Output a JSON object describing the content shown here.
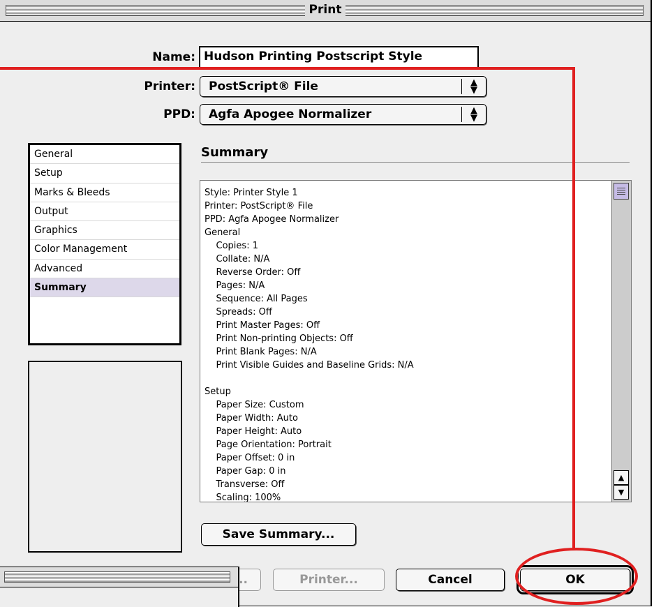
{
  "window": {
    "title": "Print"
  },
  "fields": {
    "name_label": "Name:",
    "name_value": "Hudson Printing Postscript Style",
    "printer_label": "Printer:",
    "printer_value": "PostScript® File",
    "ppd_label": "PPD:",
    "ppd_value": "Agfa Apogee Normalizer"
  },
  "panels": {
    "items": [
      {
        "label": "General"
      },
      {
        "label": "Setup"
      },
      {
        "label": "Marks & Bleeds"
      },
      {
        "label": "Output"
      },
      {
        "label": "Graphics"
      },
      {
        "label": "Color Management"
      },
      {
        "label": "Advanced"
      },
      {
        "label": "Summary"
      }
    ],
    "selected": "Summary"
  },
  "summary": {
    "title": "Summary",
    "text": "Style: Printer Style 1\nPrinter: PostScript® File\nPPD: Agfa Apogee Normalizer\nGeneral\n    Copies: 1\n    Collate: N/A\n    Reverse Order: Off\n    Pages: N/A\n    Sequence: All Pages\n    Spreads: Off\n    Print Master Pages: Off\n    Print Non-printing Objects: Off\n    Print Blank Pages: N/A\n    Print Visible Guides and Baseline Grids: N/A\n\nSetup\n    Paper Size: Custom\n    Paper Width: Auto\n    Paper Height: Auto\n    Page Orientation: Portrait\n    Paper Offset: 0 in\n    Paper Gap: 0 in\n    Transverse: Off\n    Scaling: 100%",
    "save_button": "Save Summary..."
  },
  "buttons": {
    "setup_partial": "...",
    "printer": "Printer...",
    "cancel": "Cancel",
    "ok": "OK"
  },
  "colors": {
    "annotation": "#e02020",
    "selection": "#ddd8ea",
    "scroll_thumb": "#c6bce6"
  }
}
